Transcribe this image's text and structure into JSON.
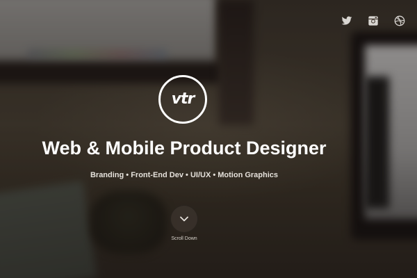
{
  "header": {
    "social": [
      {
        "name": "twitter-icon"
      },
      {
        "name": "instagram-icon"
      },
      {
        "name": "dribbble-icon"
      }
    ]
  },
  "logo": {
    "text": "vtr"
  },
  "hero": {
    "title": "Web & Mobile Product Designer",
    "subtitle": "Branding • Front-End Dev • UI/UX • Motion Graphics"
  },
  "scroll": {
    "label": "Scroll Down",
    "icon": "chevron-down-icon"
  },
  "colors": {
    "text": "#ffffff",
    "subtitle": "#e6e2dc"
  }
}
